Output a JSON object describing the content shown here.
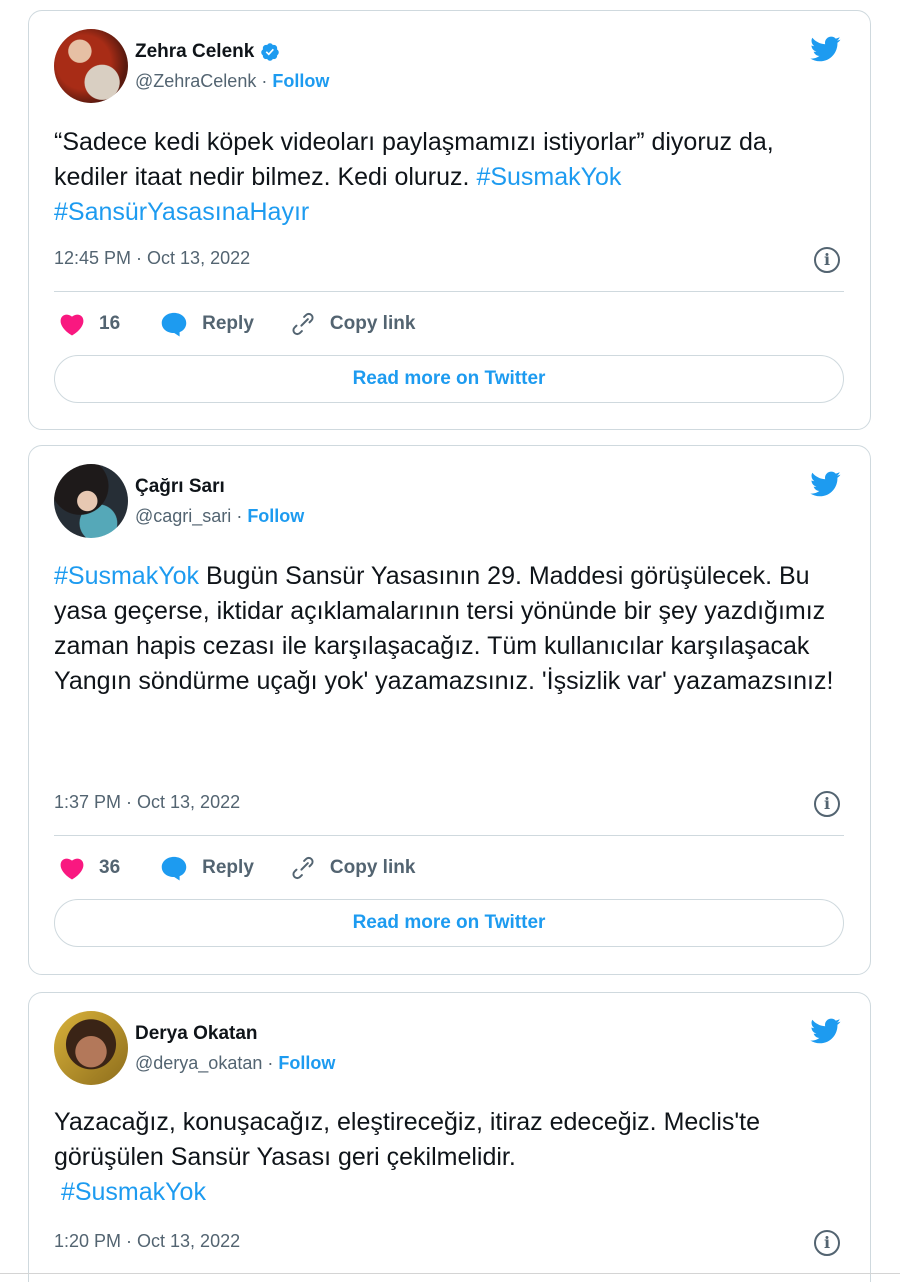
{
  "tweets": [
    {
      "name": "Zehra Celenk",
      "verified": true,
      "handle": "@ZehraCelenk",
      "separator": " · ",
      "follow": "Follow",
      "text_plain": "“Sadece kedi köpek videoları paylaşmamızı istiyorlar” diyoruz da, kediler itaat nedir bilmez. Kedi oluruz. ",
      "hashtags": "#SusmakYok #SansürYasasınaHayır",
      "timestamp": "12:45 PM · Oct 13, 2022",
      "likes": "16",
      "reply_label": "Reply",
      "copy_label": "Copy link",
      "read_more": "Read more on Twitter"
    },
    {
      "name": "Çağrı Sarı",
      "verified": false,
      "handle": "@cagri_sari",
      "separator": " · ",
      "follow": "Follow",
      "hashtag_lead": "#SusmakYok",
      "text_plain": " Bugün Sansür Yasasının 29. Maddesi görüşülecek. Bu yasa geçerse, iktidar açıklamalarının tersi yönünde bir şey yazdığımız zaman hapis cezası ile karşılaşacağız. Tüm kullanıcılar karşılaşacak",
      "text_line2": "Yangın söndürme uçağı yok' yazamazsınız. 'İşsizlik var' yazamazsınız!",
      "timestamp": "1:37 PM · Oct 13, 2022",
      "likes": "36",
      "reply_label": "Reply",
      "copy_label": "Copy link",
      "read_more": "Read more on Twitter"
    },
    {
      "name": "Derya Okatan",
      "verified": false,
      "handle": "@derya_okatan",
      "separator": " · ",
      "follow": "Follow",
      "text_plain": "Yazacağız, konuşacağız, eleştireceğiz, itiraz edeceğiz. Meclis'te görüşülen Sansür Yasası geri çekilmelidir.",
      "hashtags": "#SusmakYok",
      "timestamp": "1:20 PM · Oct 13, 2022"
    }
  ],
  "icons": {
    "twitter_bird": "twitter-bird-icon",
    "verified_badge": "verified-badge-icon",
    "info": "info-icon",
    "heart": "heart-icon",
    "reply": "reply-bubble-icon",
    "copy_link": "link-icon"
  },
  "colors": {
    "accent": "#1d9bf0",
    "heart": "#f91880",
    "text": "#0f1419",
    "muted": "#536471",
    "border": "#cfd9de"
  }
}
